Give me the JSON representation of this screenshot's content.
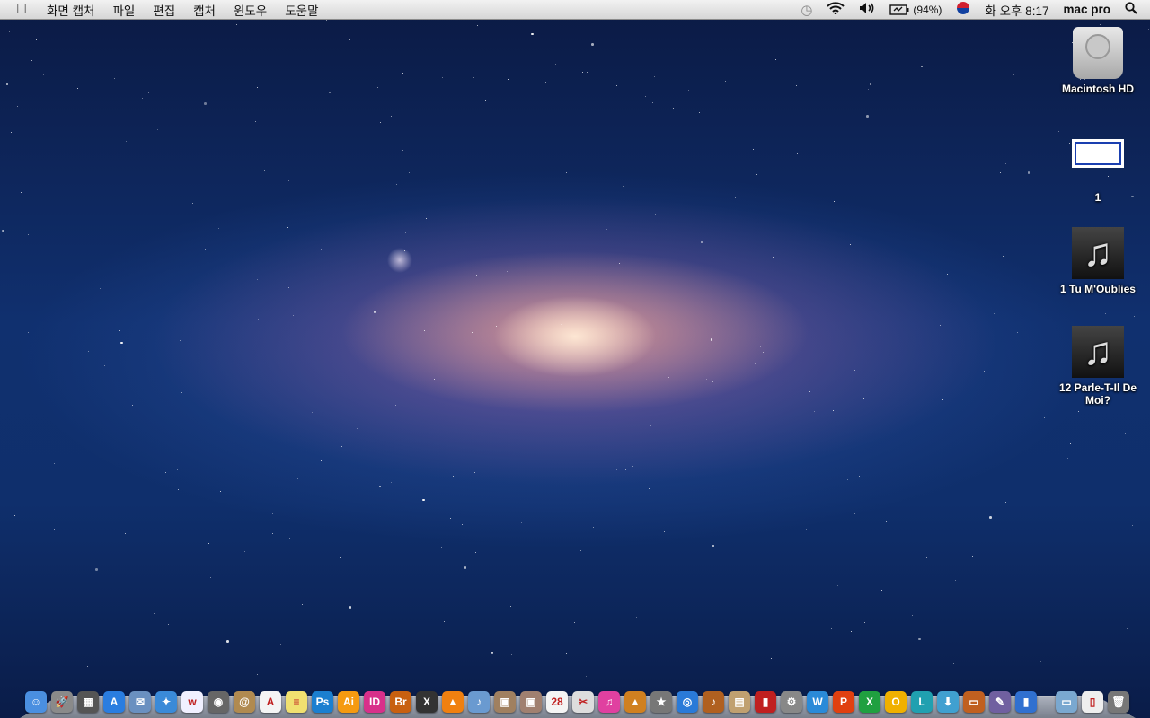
{
  "menubar": {
    "app_name": "화면 캡처",
    "items": [
      "파일",
      "편집",
      "캡처",
      "윈도우",
      "도움말"
    ],
    "battery": "(94%)",
    "clock": "화 오후 8:17",
    "user": "mac pro",
    "status_icons": [
      "time-machine-icon",
      "wifi-icon",
      "volume-icon",
      "battery-icon",
      "input-source-flag-icon",
      "spotlight-icon"
    ]
  },
  "desktop": {
    "icons": [
      {
        "label": "Macintosh HD",
        "icon": "hard-drive-icon"
      },
      {
        "label": "1",
        "icon": "screenshot-file-icon"
      },
      {
        "label": "1 Tu M'Oublies",
        "icon": "music-file-icon"
      },
      {
        "label": "12 Parle-T-Il De Moi?",
        "icon": "music-file-icon"
      }
    ]
  },
  "dock": {
    "apps": [
      {
        "name": "finder",
        "text": "☺",
        "color": "#4a8fe0"
      },
      {
        "name": "launchpad",
        "text": "🚀",
        "color": "#8a8a8a"
      },
      {
        "name": "mission-control",
        "text": "▦",
        "color": "#555"
      },
      {
        "name": "app-store",
        "text": "A",
        "color": "#2a7de0"
      },
      {
        "name": "preview",
        "text": "✉",
        "color": "#6a90c0"
      },
      {
        "name": "safari",
        "text": "✦",
        "color": "#3a8ad8"
      },
      {
        "name": "wacom",
        "text": "w",
        "color": "#f0f0ff"
      },
      {
        "name": "facetime",
        "text": "◉",
        "color": "#666"
      },
      {
        "name": "address-book",
        "text": "@",
        "color": "#b08a50"
      },
      {
        "name": "acrobat",
        "text": "A",
        "color": "#f4f4f4"
      },
      {
        "name": "stickies",
        "text": "≡",
        "color": "#f0e070"
      },
      {
        "name": "photoshop",
        "text": "Ps",
        "color": "#1b7fd0"
      },
      {
        "name": "illustrator",
        "text": "Ai",
        "color": "#f59a10"
      },
      {
        "name": "indesign",
        "text": "ID",
        "color": "#d8308a"
      },
      {
        "name": "bridge",
        "text": "Br",
        "color": "#c86010"
      },
      {
        "name": "crossover",
        "text": "X",
        "color": "#333"
      },
      {
        "name": "vlc",
        "text": "▲",
        "color": "#f08010"
      },
      {
        "name": "utility",
        "text": "♪",
        "color": "#6a9ad0"
      },
      {
        "name": "installer-1",
        "text": "▣",
        "color": "#a08060"
      },
      {
        "name": "installer-2",
        "text": "▣",
        "color": "#a08070"
      },
      {
        "name": "calendar",
        "text": "28",
        "color": "#f4f4f4"
      },
      {
        "name": "directory-utility",
        "text": "✂",
        "color": "#ddd"
      },
      {
        "name": "itunes",
        "text": "♫",
        "color": "#e040a0"
      },
      {
        "name": "iphoto",
        "text": "▲",
        "color": "#d08020"
      },
      {
        "name": "imovie",
        "text": "★",
        "color": "#777"
      },
      {
        "name": "dvd-player",
        "text": "◎",
        "color": "#2a7ad8"
      },
      {
        "name": "garageband",
        "text": "♪",
        "color": "#b06020"
      },
      {
        "name": "pages",
        "text": "▤",
        "color": "#c0a070"
      },
      {
        "name": "photo-booth",
        "text": "▮",
        "color": "#c02020"
      },
      {
        "name": "system-preferences",
        "text": "⚙",
        "color": "#888"
      },
      {
        "name": "word",
        "text": "W",
        "color": "#2a8ad8"
      },
      {
        "name": "powerpoint",
        "text": "P",
        "color": "#e04010"
      },
      {
        "name": "excel",
        "text": "X",
        "color": "#20a040"
      },
      {
        "name": "outlook",
        "text": "O",
        "color": "#f0b000"
      },
      {
        "name": "lync",
        "text": "L",
        "color": "#20a0b0"
      },
      {
        "name": "downloader",
        "text": "⬇",
        "color": "#40a0d0"
      },
      {
        "name": "keynote",
        "text": "▭",
        "color": "#c06020"
      },
      {
        "name": "script-editor",
        "text": "✎",
        "color": "#7060a0"
      },
      {
        "name": "numbers",
        "text": "▮",
        "color": "#3070d0"
      }
    ],
    "stacks": [
      {
        "name": "applications-folder",
        "text": "▭",
        "color": "#7aa8d0"
      },
      {
        "name": "documents",
        "text": "▯",
        "color": "#eee"
      },
      {
        "name": "trash",
        "text": "🗑",
        "color": "#777"
      }
    ]
  }
}
